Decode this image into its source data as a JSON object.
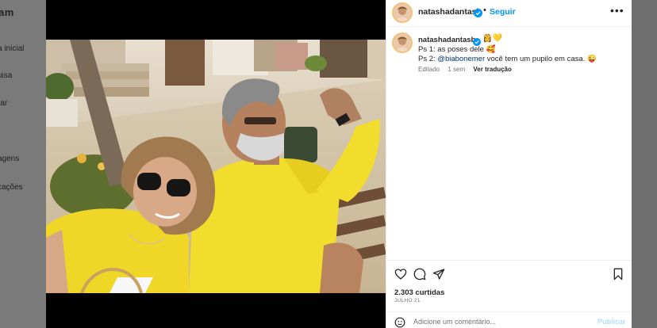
{
  "sidebar": {
    "logo": "am",
    "items": [
      {
        "label": "a inicial"
      },
      {
        "label": "uisa"
      },
      {
        "label": "rar"
      },
      {
        "label": "agens"
      },
      {
        "label": "cações"
      }
    ]
  },
  "post": {
    "username": "natashadantasb",
    "follow_label": "Seguir",
    "separator": "•",
    "more_label": "•••",
    "caption": {
      "username": "natashadantasb",
      "emojis": "👸💛",
      "line1": "Ps 1: as poses dele 🥰",
      "line2_prefix": "Ps 2: ",
      "line2_mention": "@biabonemer",
      "line2_suffix": " você tem um pupilo em casa. 😜",
      "edited": "Editado",
      "age": "1 sem",
      "translate": "Ver tradução"
    },
    "likes": "2.303 curtidas",
    "date": "JULHO 21",
    "comment_placeholder": "Adicione um comentário...",
    "post_label": "Publicar"
  },
  "colors": {
    "accent": "#0095f6",
    "verified": "#0095f6",
    "shirt_yellow": "#f2dc2c"
  },
  "icons": {
    "like": "heart-icon",
    "comment": "comment-icon",
    "share": "share-icon",
    "save": "bookmark-icon",
    "more": "more-options-icon",
    "verified": "verified-badge-icon",
    "emoji": "emoji-icon"
  }
}
